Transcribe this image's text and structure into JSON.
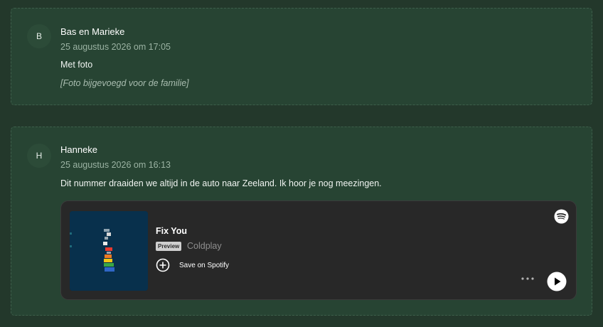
{
  "posts": [
    {
      "avatar": "B",
      "author": "Bas en Marieke",
      "date": "25 augustus 2026 om 17:05",
      "message": "Met foto",
      "note": "[Foto bijgevoegd voor de familie]"
    },
    {
      "avatar": "H",
      "author": "Hanneke",
      "date": "25 augustus 2026 om 16:13",
      "message": "Dit nummer draaiden we altijd in de auto naar Zeeland. Ik hoor je nog meezingen.",
      "embed": {
        "provider": "Spotify",
        "title": "Fix You",
        "badge": "Preview",
        "artist": "Coldplay",
        "save_label": "Save on Spotify",
        "icons": [
          "spotify-logo-icon",
          "plus-circle-icon",
          "more-icon",
          "play-icon"
        ]
      }
    }
  ],
  "colors": {
    "page_background": "#23382b",
    "card_background": "#274433",
    "embed_background": "#282828",
    "spotify_green": "#1db954"
  }
}
